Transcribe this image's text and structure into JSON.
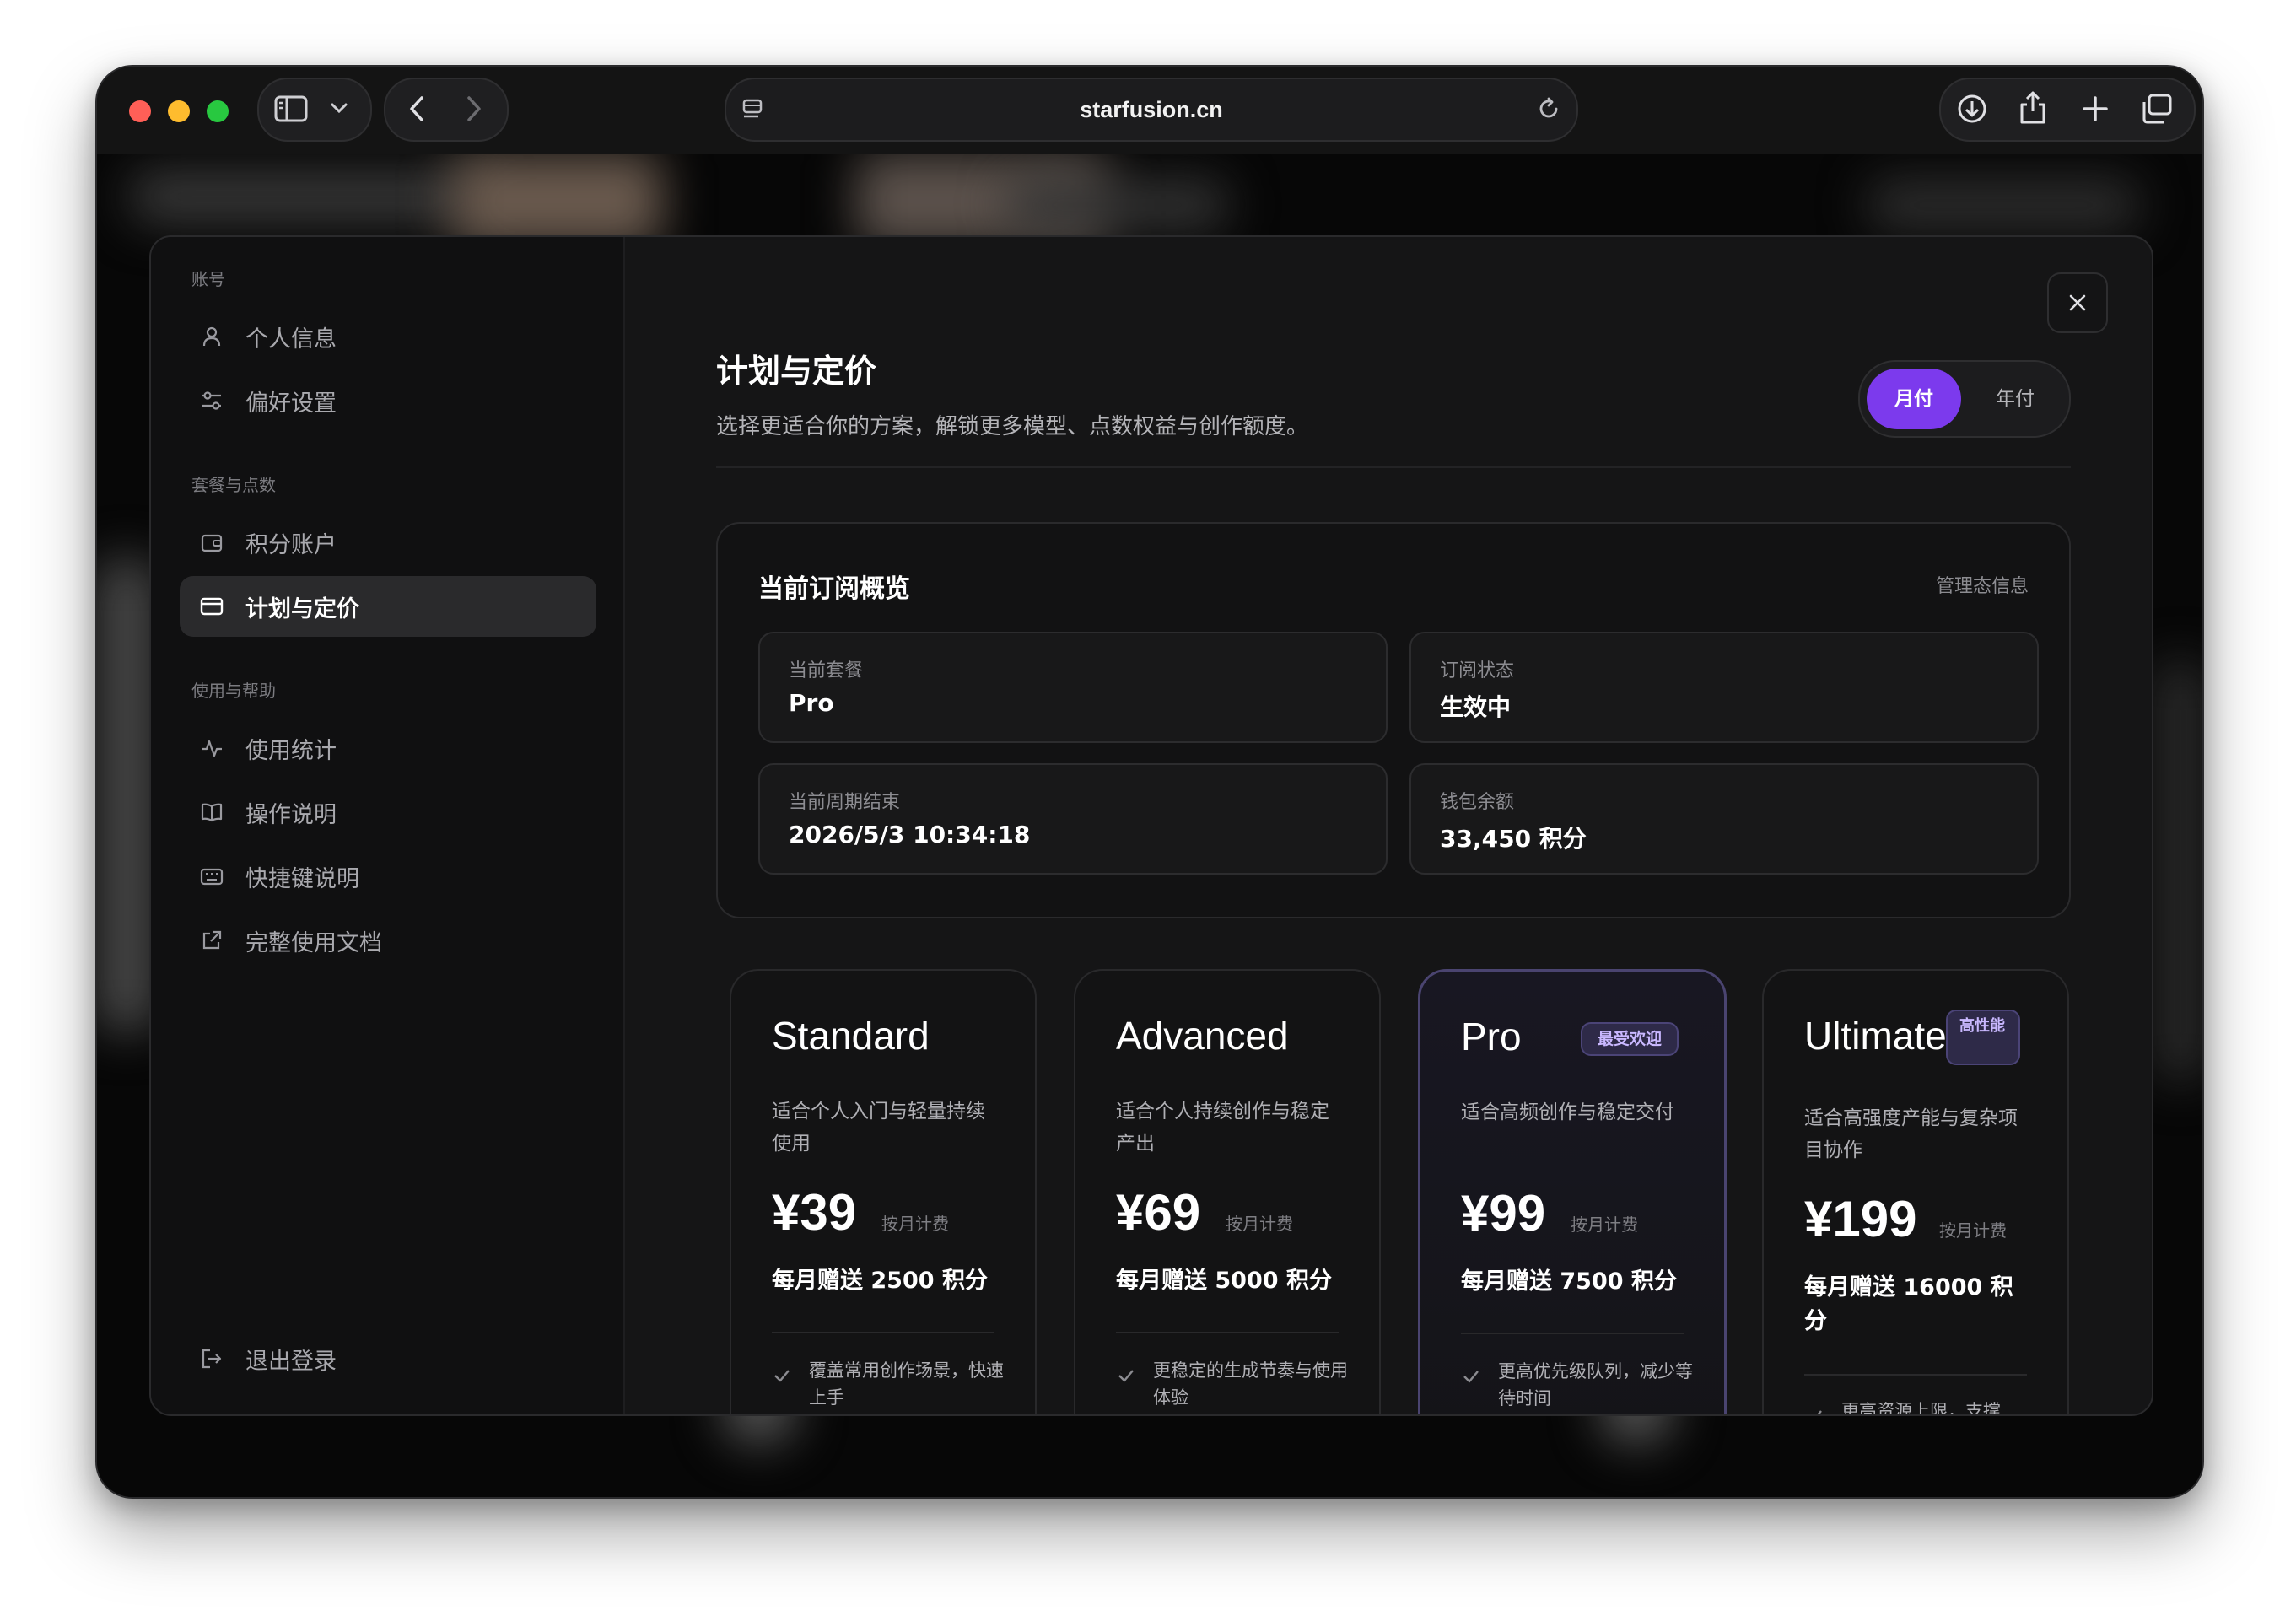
{
  "browser": {
    "url": "starfusion.cn"
  },
  "sidebar": {
    "sections": [
      {
        "label": "账号"
      },
      {
        "label": "套餐与点数"
      },
      {
        "label": "使用与帮助"
      }
    ],
    "items": [
      {
        "label": "个人信息",
        "icon": "user-icon"
      },
      {
        "label": "偏好设置",
        "icon": "sliders-icon"
      },
      {
        "label": "积分账户",
        "icon": "wallet-icon"
      },
      {
        "label": "计划与定价",
        "icon": "card-icon",
        "active": true
      },
      {
        "label": "使用统计",
        "icon": "activity-icon"
      },
      {
        "label": "操作说明",
        "icon": "book-icon"
      },
      {
        "label": "快捷键说明",
        "icon": "keyboard-icon"
      },
      {
        "label": "完整使用文档",
        "icon": "external-link-icon"
      }
    ],
    "logout": "退出登录"
  },
  "header": {
    "title": "计划与定价",
    "subtitle": "选择更适合你的方案，解锁更多模型、点数权益与创作额度。",
    "billing": {
      "monthly": "月付",
      "yearly": "年付",
      "selected": "月付"
    }
  },
  "overview": {
    "title": "当前订阅概览",
    "link": "管理态信息",
    "fields": [
      {
        "key": "当前套餐",
        "value": "Pro"
      },
      {
        "key": "订阅状态",
        "value": "生效中"
      },
      {
        "key": "当前周期结束",
        "value": "2026/5/3 10:34:18"
      },
      {
        "key": "钱包余额",
        "value": "33,450 积分"
      }
    ]
  },
  "plans": [
    {
      "name": "Standard",
      "badge": "",
      "desc": "适合个人入门与轻量持续使用",
      "price": "¥39",
      "cycle": "按月计费",
      "credits": "每月赠送 2500 积分",
      "feature": "覆盖常用创作场景，快速上手"
    },
    {
      "name": "Advanced",
      "badge": "",
      "desc": "适合个人持续创作与稳定产出",
      "price": "¥69",
      "cycle": "按月计费",
      "credits": "每月赠送 5000 积分",
      "feature": "更稳定的生成节奏与使用体验"
    },
    {
      "name": "Pro",
      "badge": "最受欢迎",
      "desc": "适合高频创作与稳定交付",
      "price": "¥99",
      "cycle": "按月计费",
      "credits": "每月赠送 7500 积分",
      "feature": "更高优先级队列，减少等待时间"
    },
    {
      "name": "Ultimate",
      "badge": "高性能",
      "desc": "适合高强度产能与复杂项目协作",
      "price": "¥199",
      "cycle": "按月计费",
      "credits": "每月赠送 16000 积分",
      "feature": "更高资源上限，支撑"
    }
  ],
  "colors": {
    "accent": "#7c3aed",
    "background": "#0a0a0b",
    "panel": "#151516"
  }
}
